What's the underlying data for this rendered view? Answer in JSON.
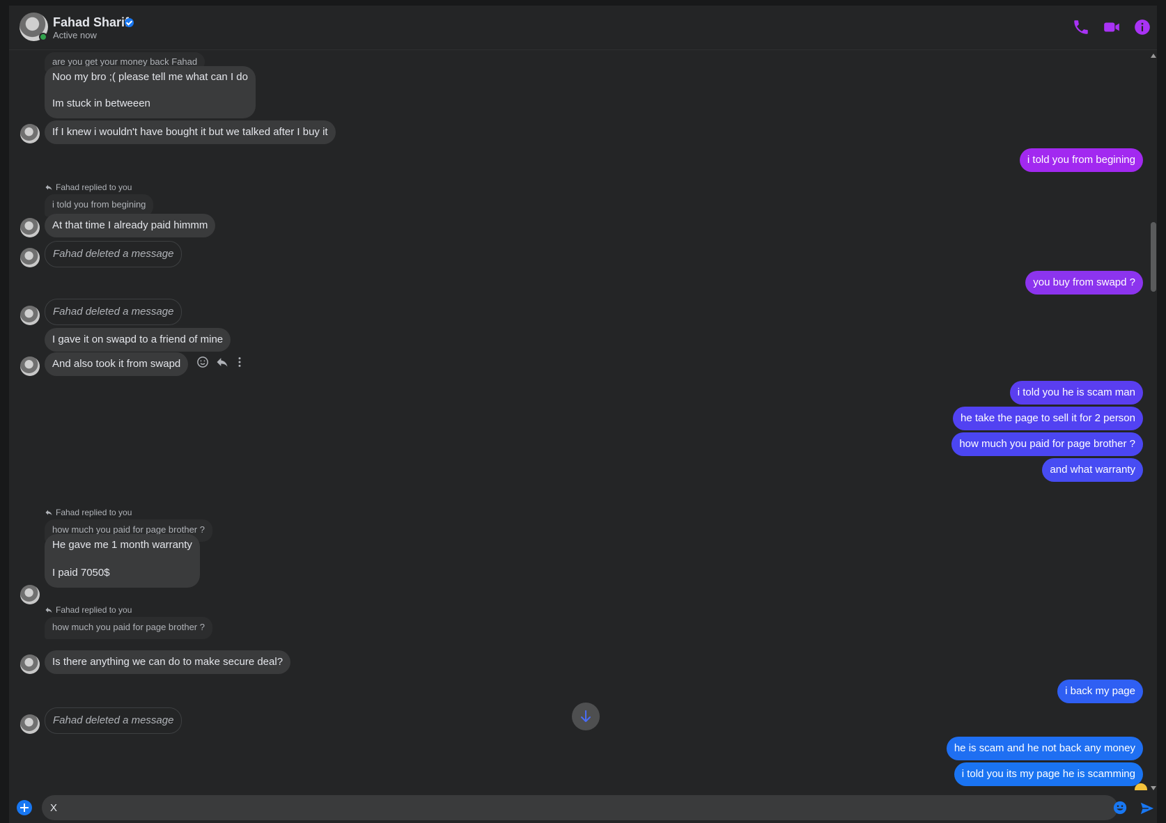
{
  "header": {
    "name": "Fahad Sharif",
    "status": "Active now",
    "accent_color": "#a933f5"
  },
  "messages": {
    "quote_1": "are you get your money back Fahad",
    "in_1a": "Noo my bro ;( please tell me what can I do",
    "in_1b": "Im stuck in betweeen",
    "in_2": "If I knew i wouldn't have bought it but we talked after I buy it",
    "out_1": "i told you from begining",
    "reply_note_1": "Fahad replied to you",
    "quote_2": "i told you from begining",
    "in_3": "At that time I already paid himmm",
    "deleted_1": "Fahad deleted a message",
    "out_2": "you buy from swapd ?",
    "deleted_2": "Fahad deleted a message",
    "in_4": "I gave it on swapd to a friend of mine",
    "in_5": "And also took it from swapd",
    "out_3": "i told you he is scam man",
    "out_4": "he take the page to sell it for 2 person",
    "out_5": "how much you paid for page brother ?",
    "out_6": "and what warranty",
    "reply_note_2": "Fahad replied to you",
    "quote_3": "how much you paid for page brother ?",
    "in_6a": "He gave me 1 month warranty",
    "in_6b": "I paid 7050$",
    "reply_note_3": "Fahad replied to you",
    "quote_4": "how much you paid for page brother ?",
    "in_7": "Is there anything we can do to make secure deal?",
    "out_7": "i back my page",
    "deleted_3": "Fahad deleted a message",
    "out_8": "he is scam and he not back any money",
    "out_9": "i told you its my page he is scamming"
  },
  "composer": {
    "value": "X"
  },
  "icons": [
    "phone-icon",
    "video-icon",
    "info-icon",
    "verified-icon",
    "smile-icon",
    "reply-icon",
    "more-icon",
    "arrow-down-icon",
    "plus-icon",
    "emoji-icon",
    "send-icon"
  ]
}
